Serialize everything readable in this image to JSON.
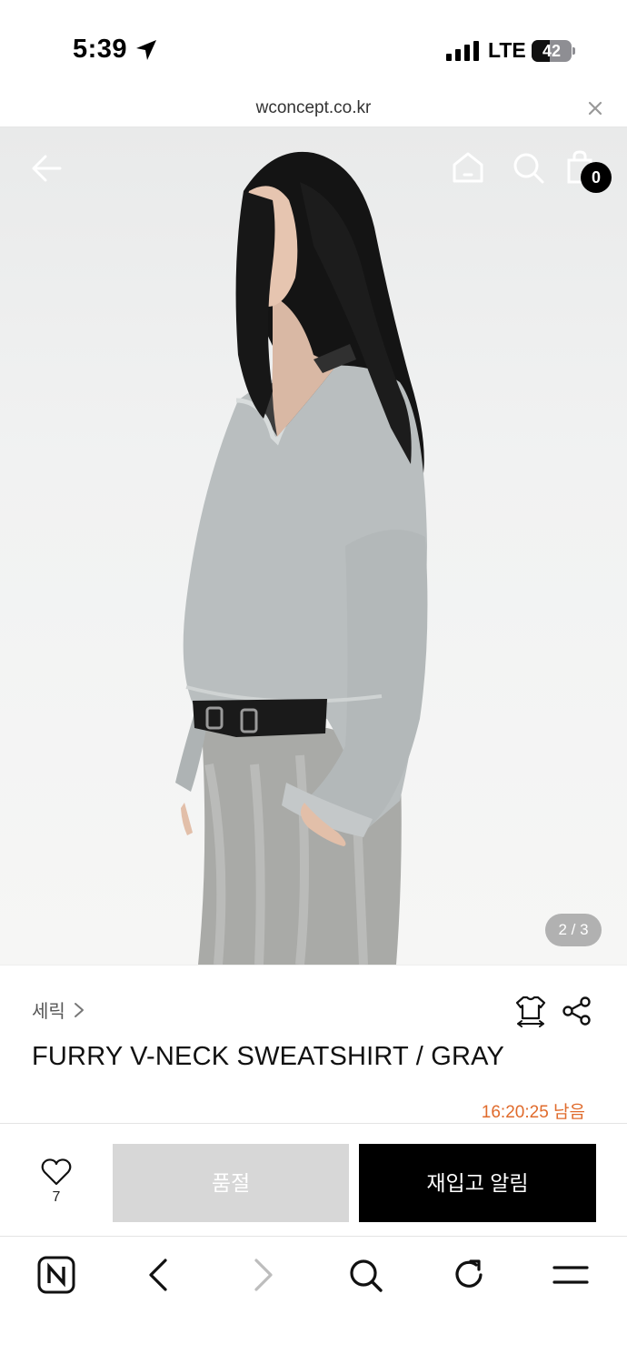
{
  "status_bar": {
    "time": "5:39",
    "network": "LTE",
    "battery": "42"
  },
  "browser": {
    "url": "wconcept.co.kr"
  },
  "header": {
    "cart_count": "0"
  },
  "gallery": {
    "pager": "2 / 3"
  },
  "product": {
    "brand": "세릭",
    "name": "FURRY V-NECK SWEATSHIRT / GRAY",
    "countdown": "16:20:25 남음"
  },
  "actions": {
    "like_count": "7",
    "soldout_label": "품절",
    "restock_label": "재입고 알림"
  },
  "colors": {
    "accent_orange": "#e06b2c",
    "soldout_gray": "#d7d7d7",
    "primary_black": "#000000"
  }
}
